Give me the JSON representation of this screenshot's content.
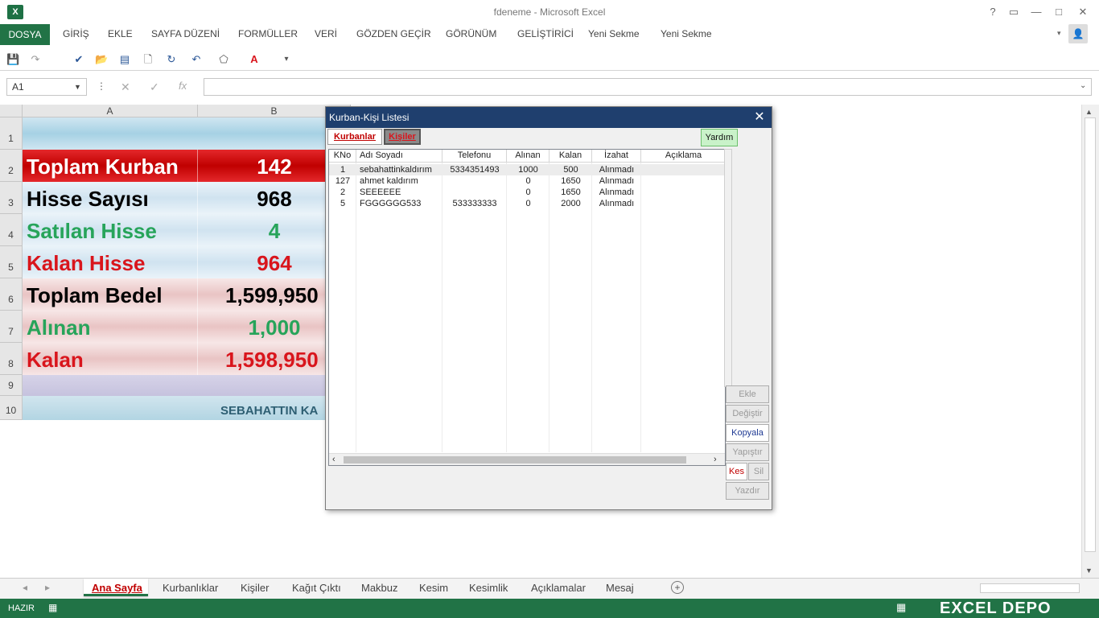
{
  "window": {
    "title": "fdeneme - Microsoft Excel",
    "icon_text": "X"
  },
  "ribbon": {
    "file_tab": "DOSYA",
    "tabs": [
      "GİRİŞ",
      "EKLE",
      "SAYFA DÜZENİ",
      "FORMÜLLER",
      "VERİ",
      "GÖZDEN GEÇİR",
      "GÖRÜNÜM",
      "GELİŞTİRİCİ",
      "Yeni Sekme",
      "Yeni Sekme"
    ]
  },
  "formula_bar": {
    "name_box": "A1",
    "fx": "fx",
    "formula": ""
  },
  "grid": {
    "columns": [
      "A",
      "B"
    ],
    "rows": [
      "1",
      "2",
      "3",
      "4",
      "5",
      "6",
      "7",
      "8",
      "9",
      "10"
    ],
    "labels": {
      "toplam_kurban": "Toplam Kurban",
      "hisse_sayisi": "Hisse Sayısı",
      "satilan_hisse": "Satılan Hisse",
      "kalan_hisse": "Kalan Hisse",
      "toplam_bedel": "Toplam Bedel",
      "alinan": "Alınan",
      "kalan": "Kalan"
    },
    "values": {
      "toplam_kurban": "142",
      "hisse_sayisi": "968",
      "satilan_hisse": "4",
      "kalan_hisse": "964",
      "toplam_bedel": "1,599,950",
      "alinan": "1,000",
      "kalan": "1,598,950"
    },
    "footer": "SEBAHATTIN KA"
  },
  "dialog": {
    "title": "Kurban-Kişi Listesi",
    "tabs": {
      "kurbanlar": "Kurbanlar",
      "kisiler": "Kişiler"
    },
    "help": "Yardım",
    "columns": [
      "KNo",
      "Adı Soyadı",
      "Telefonu",
      "Alınan",
      "Kalan",
      "İzahat",
      "Açıklama"
    ],
    "rows": [
      [
        "1",
        "sebahattinkaldırım",
        "5334351493",
        "1000",
        "500",
        "Alınmadı",
        ""
      ],
      [
        "127",
        "ahmet kaldırım",
        "",
        "0",
        "1650",
        "Alınmadı",
        ""
      ],
      [
        "2",
        "SEEEEEE",
        "",
        "0",
        "1650",
        "Alınmadı",
        ""
      ],
      [
        "5",
        "FGGGGGG533",
        "533333333",
        "0",
        "2000",
        "Alınmadı",
        ""
      ]
    ],
    "buttons": {
      "ekle": "Ekle",
      "degistir": "Değiştir",
      "kopyala": "Kopyala",
      "yapistir": "Yapıştır",
      "kes": "Kes",
      "sil": "Sil",
      "yazdir": "Yazdır"
    }
  },
  "sheets": [
    "Ana Sayfa",
    "Kurbanlıklar",
    "Kişiler",
    "Kağıt Çıktı",
    "Makbuz",
    "Kesim",
    "Kesimlik",
    "Açıklamalar",
    "Mesaj"
  ],
  "status": {
    "mode": "HAZIR",
    "watermark": "EXCEL DEPO"
  },
  "colors": {
    "excel_green": "#217346",
    "red": "#d9151c",
    "green_text": "#27a45a",
    "dialog_title": "#1f3f6e"
  }
}
